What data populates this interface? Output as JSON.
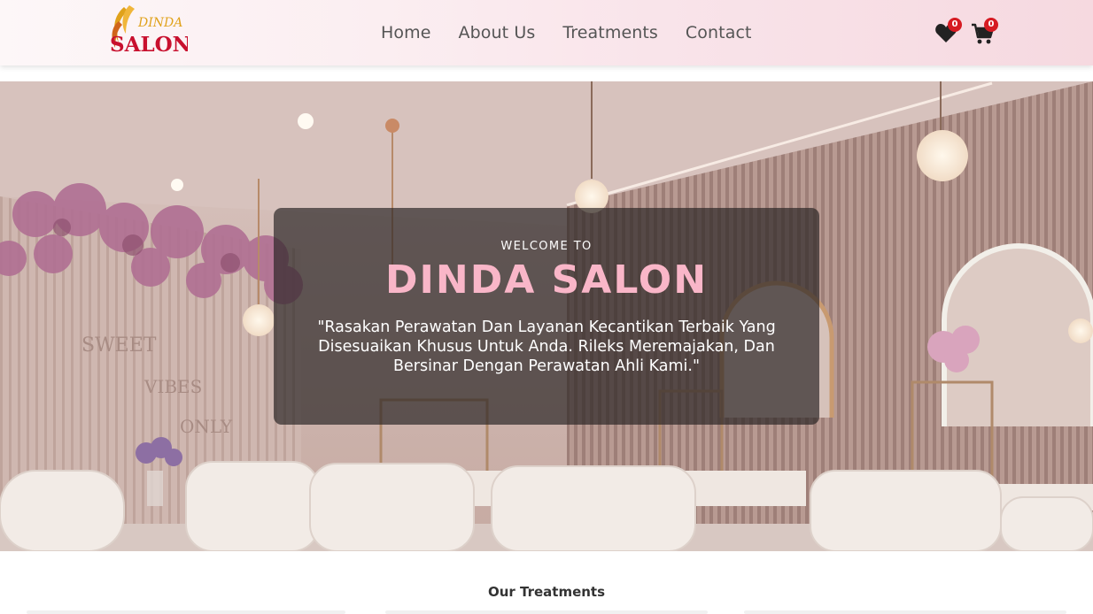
{
  "brand": {
    "logo_top": "DINDA",
    "logo_bottom": "SALON"
  },
  "nav": {
    "items": [
      {
        "label": "Home"
      },
      {
        "label": "About Us"
      },
      {
        "label": "Treatments"
      },
      {
        "label": "Contact"
      }
    ]
  },
  "actions": {
    "wishlist": {
      "icon": "heart-icon",
      "count": "0"
    },
    "cart": {
      "icon": "cart-icon",
      "count": "0"
    }
  },
  "hero": {
    "eyebrow": "WELCOME TO",
    "title": "DINDA SALON",
    "subtitle": "\"Rasakan Perawatan Dan Layanan Kecantikan Terbaik Yang Disesuaikan Khusus Untuk Anda. Rileks Meremajakan, Dan Bersinar Dengan Perawatan Ahli Kami.\"",
    "wall_text": [
      "SWEET",
      "VIBES",
      "ONLY"
    ]
  },
  "treatments": {
    "heading": "Our Treatments"
  },
  "colors": {
    "accent_pink": "#f9b6c8",
    "badge_red": "#d61a22",
    "logo_red": "#c8102e",
    "logo_gold": "#e0a21b"
  }
}
